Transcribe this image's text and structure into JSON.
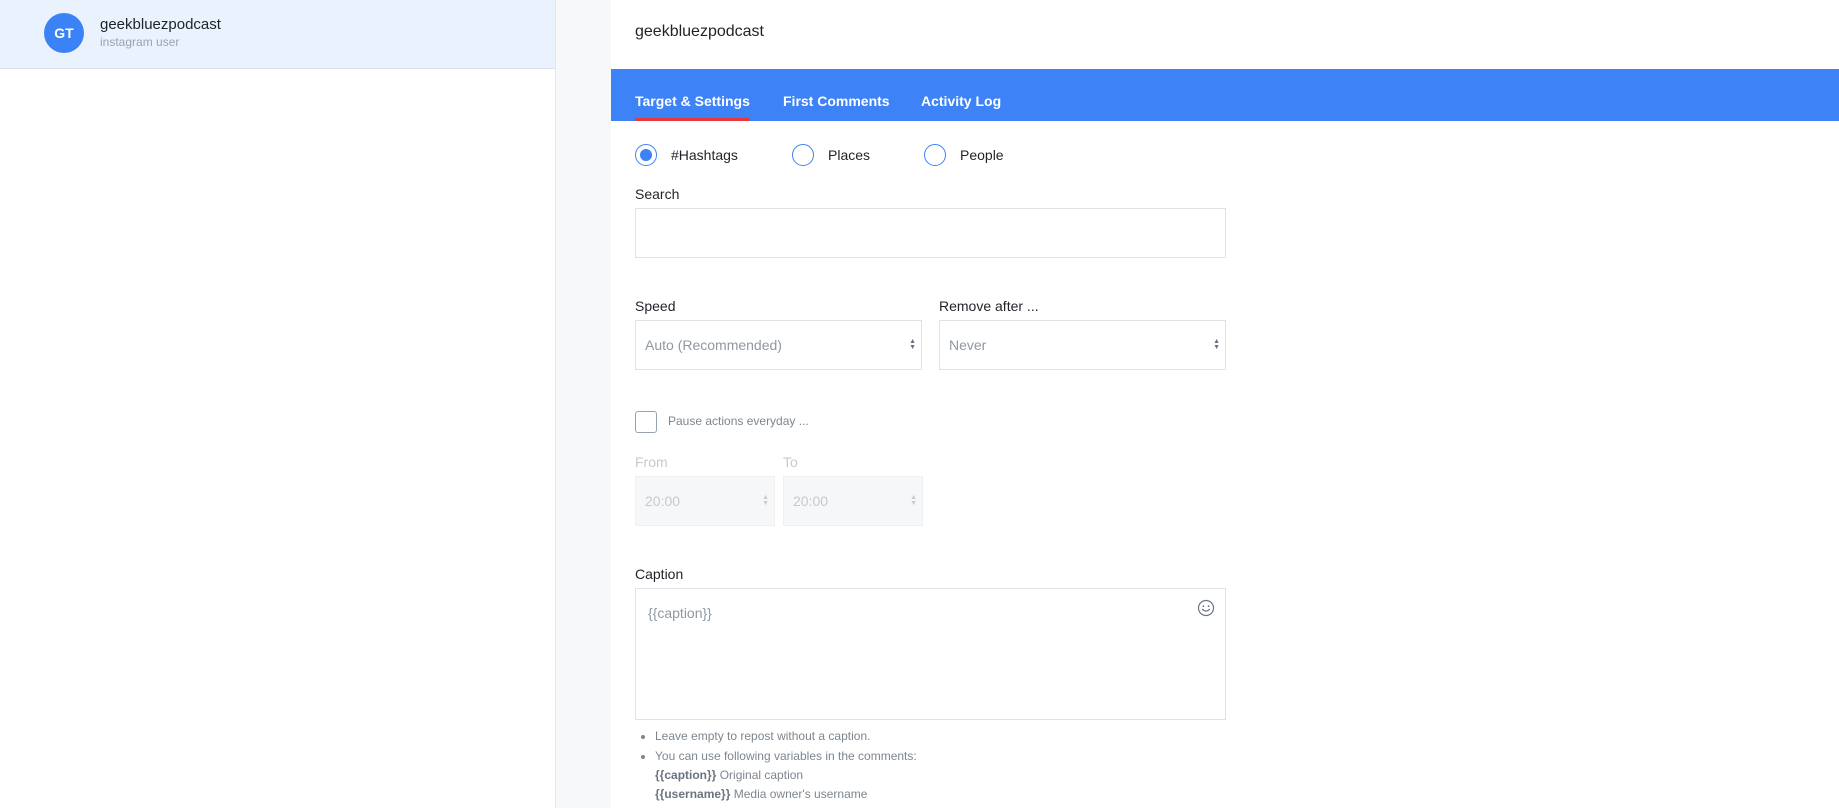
{
  "account": {
    "initials": "GT",
    "name": "geekbluezpodcast",
    "type": "instagram user"
  },
  "main": {
    "title": "geekbluezpodcast",
    "tabs": [
      {
        "label": "Target & Settings",
        "active": true
      },
      {
        "label": "First Comments",
        "active": false
      },
      {
        "label": "Activity Log",
        "active": false
      }
    ],
    "target_options": [
      {
        "label": "#Hashtags",
        "selected": true
      },
      {
        "label": "Places",
        "selected": false
      },
      {
        "label": "People",
        "selected": false
      }
    ],
    "search": {
      "label": "Search",
      "value": "",
      "placeholder": ""
    },
    "speed": {
      "label": "Speed",
      "selected": "Auto (Recommended)"
    },
    "remove_after": {
      "label": "Remove after ...",
      "selected": "Never"
    },
    "pause": {
      "label": "Pause actions everyday ...",
      "checked": false
    },
    "from": {
      "label": "From",
      "selected": "20:00"
    },
    "to": {
      "label": "To",
      "selected": "20:00"
    },
    "caption": {
      "label": "Caption",
      "placeholder": "{{caption}}"
    },
    "notes": {
      "line1": "Leave empty to repost without a caption.",
      "line2": "You can use following variables in the comments:",
      "var1_token": "{{caption}}",
      "var1_desc": "Original caption",
      "var2_token": "{{username}}",
      "var2_desc": "Media owner's username"
    }
  },
  "colors": {
    "accent": "#3d82f7",
    "tab_underline": "#e8383d",
    "selected_row_bg": "#eaf2fd"
  },
  "icons": {
    "radio_selected": "radio-filled",
    "radio_unselected": "radio-empty",
    "select_arrows": "up-down-arrows",
    "emoji": "smiley-icon"
  }
}
